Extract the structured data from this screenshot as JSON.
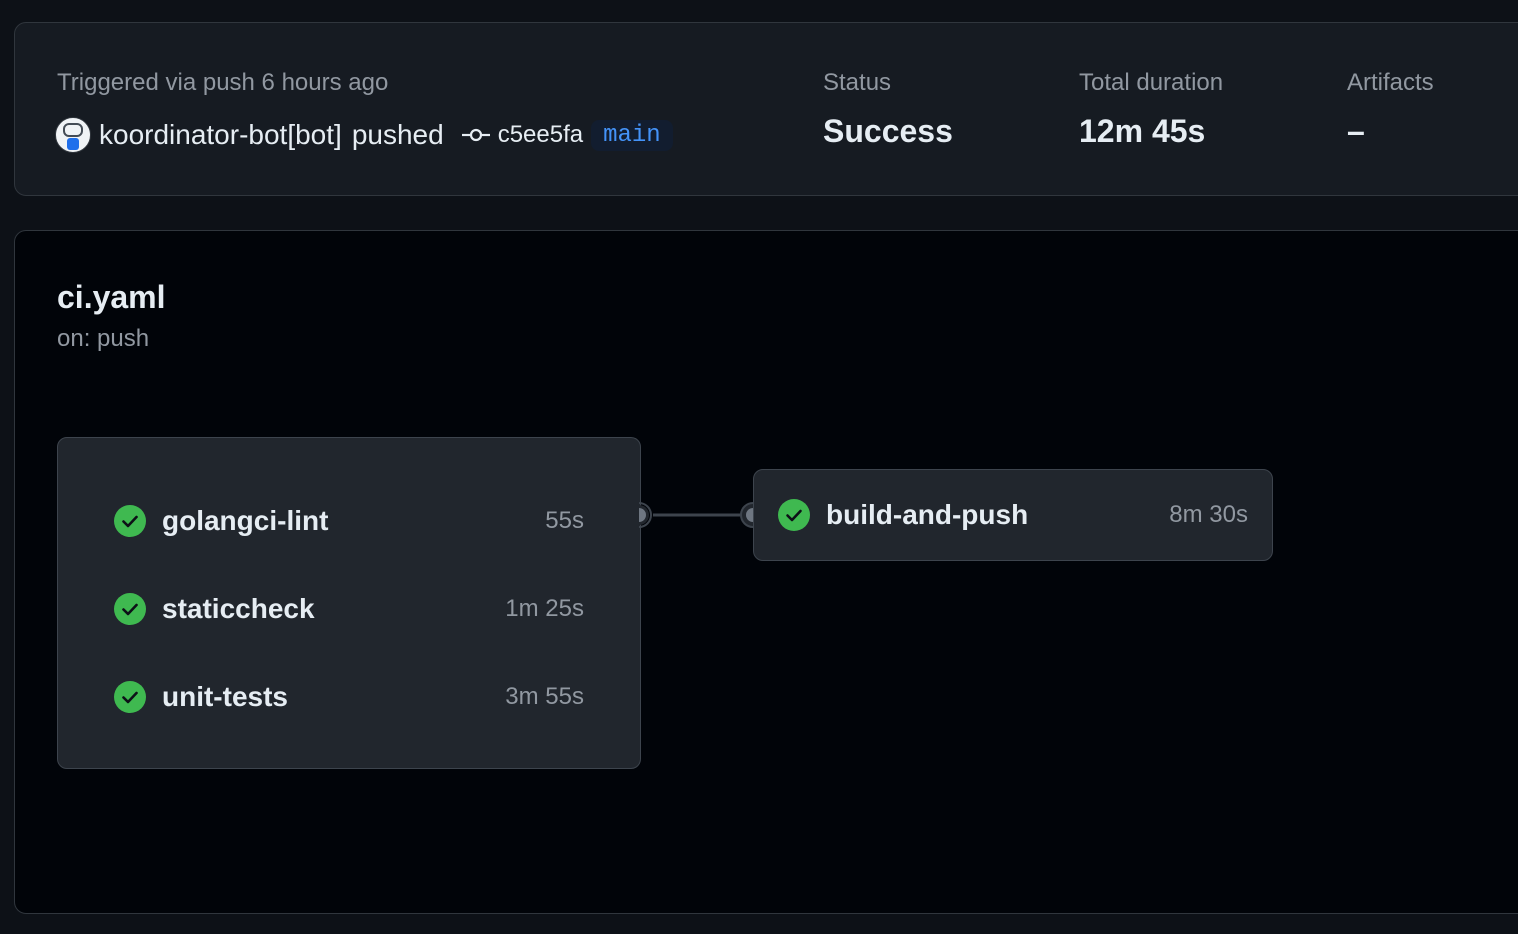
{
  "run": {
    "trigger_label": "Triggered via push 6 hours ago",
    "actor": "koordinator-bot[bot]",
    "action": "pushed",
    "commit_sha": "c5ee5fa",
    "branch": "main"
  },
  "metrics": {
    "status_label": "Status",
    "status_value": "Success",
    "duration_label": "Total duration",
    "duration_value": "12m 45s",
    "artifacts_label": "Artifacts",
    "artifacts_value": "–"
  },
  "workflow": {
    "name": "ci.yaml",
    "trigger": "on: push",
    "job_groups": [
      {
        "jobs": [
          {
            "name": "golangci-lint",
            "duration": "55s",
            "status": "success"
          },
          {
            "name": "staticcheck",
            "duration": "1m 25s",
            "status": "success"
          },
          {
            "name": "unit-tests",
            "duration": "3m 55s",
            "status": "success"
          }
        ]
      },
      {
        "jobs": [
          {
            "name": "build-and-push",
            "duration": "8m 30s",
            "status": "success"
          }
        ]
      }
    ]
  },
  "colors": {
    "success": "#3fb950",
    "branch_text": "#4493f8",
    "muted": "#9198a1"
  },
  "icons": {
    "commit": "git-commit-icon",
    "job_status": "check-circle-fill-icon"
  }
}
